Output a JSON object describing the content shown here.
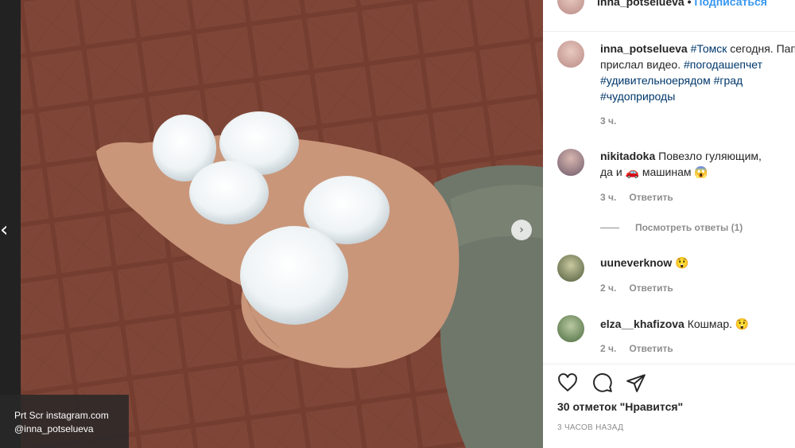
{
  "media": {
    "credit_line1": "Prt Scr instagram.com",
    "credit_line2": "@inna_potselueva"
  },
  "header": {
    "username": "inna_potselueva",
    "separator": " • ",
    "follow_label": "Подписаться"
  },
  "caption": {
    "username": "inna_potselueva",
    "hashtag_city": "#Томск",
    "text": " сегодня. Папа прислал видео. ",
    "hashtags": [
      "#погодашепчет",
      "#удивительноерядом",
      "#град",
      "#чудоприроды"
    ],
    "time": "3 ч."
  },
  "comments": [
    {
      "username": "nikitadoka",
      "text_line1": "Повезло гуляющим,",
      "text_line2": "да и 🚗 машинам 😱",
      "time": "3 ч.",
      "reply_label": "Ответить"
    },
    {
      "username": "uuneverknow",
      "text": "😲",
      "time": "2 ч.",
      "reply_label": "Ответить"
    },
    {
      "username": "elza__khafizova",
      "text": "Кошмар. 😲",
      "time": "2 ч.",
      "reply_label": "Ответить"
    }
  ],
  "view_replies": "Посмотреть ответы (1)",
  "actions": {
    "likes": "30 отметок \"Нравится\"",
    "post_time": "3 ЧАСОВ НАЗАД"
  },
  "icons": [
    "heart-icon",
    "comment-icon",
    "share-icon",
    "chevron-left-icon",
    "chevron-right-icon"
  ]
}
